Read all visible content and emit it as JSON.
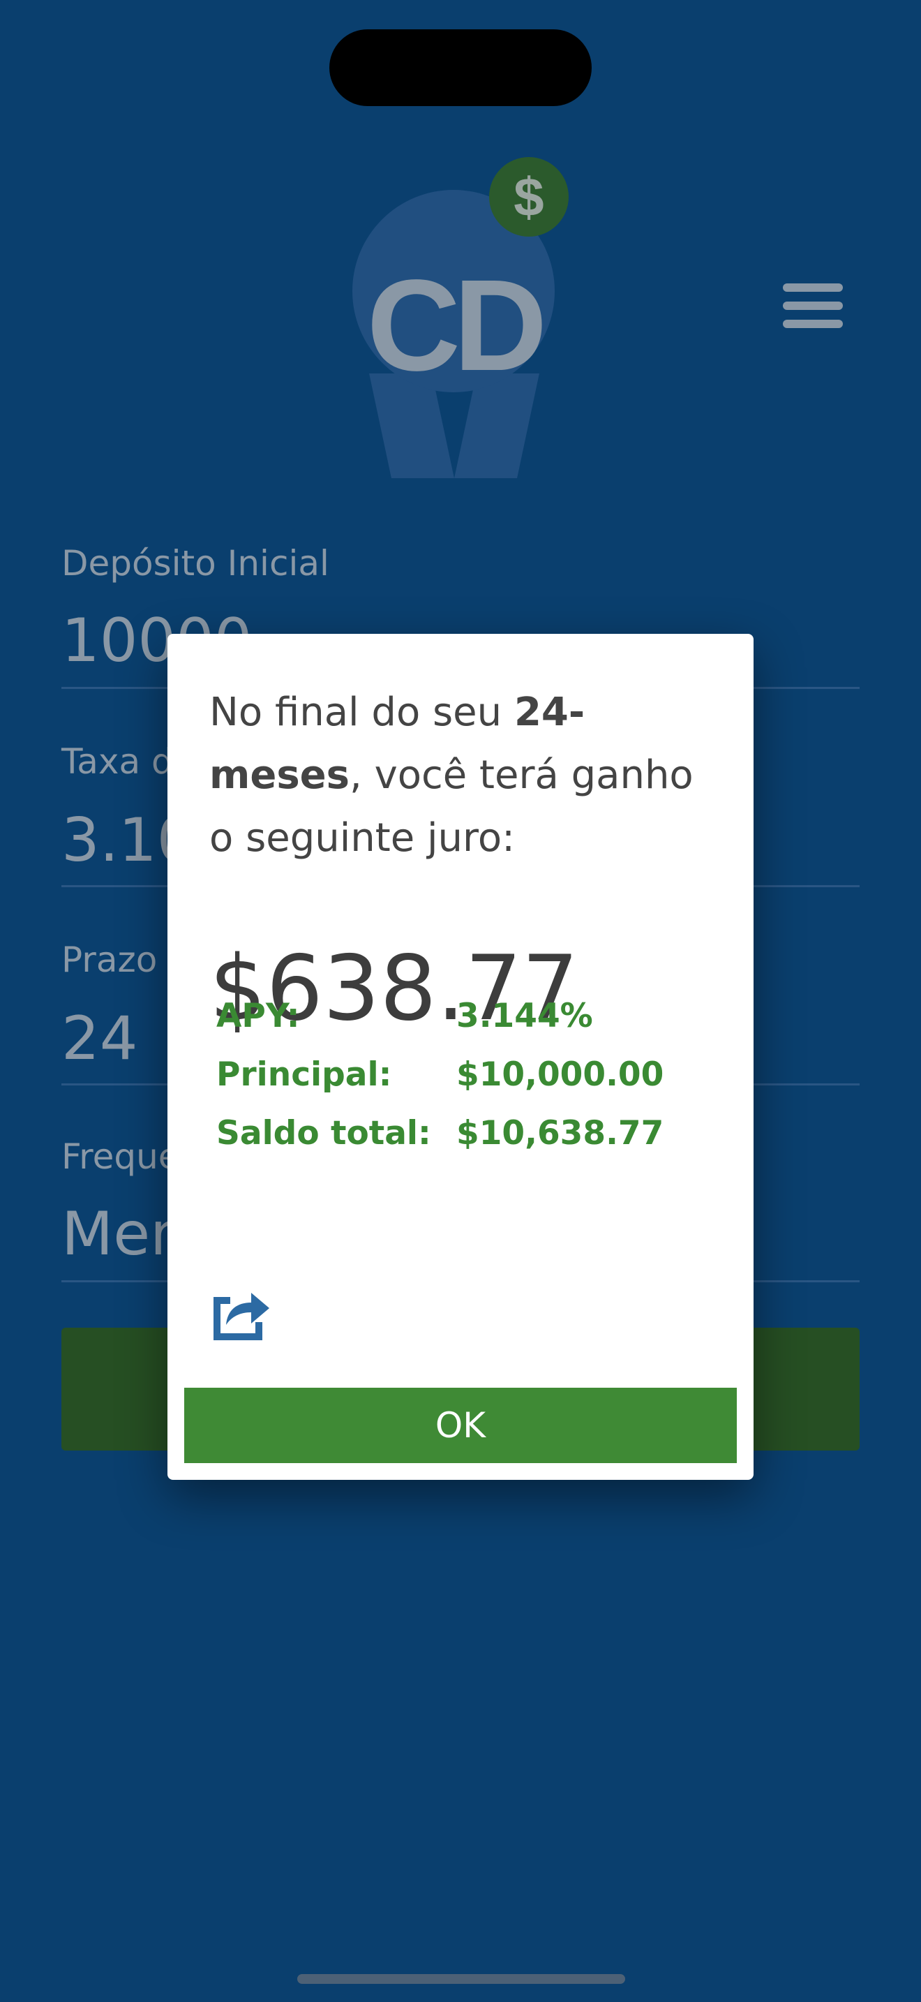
{
  "app": {
    "logo_text": "CD",
    "coin_symbol": "$"
  },
  "form": {
    "fields": [
      {
        "label": "Depósito Inicial",
        "value": "10000"
      },
      {
        "label": "Taxa d",
        "value": "3.10"
      },
      {
        "label": "Prazo",
        "value": "24"
      },
      {
        "label": "Freque",
        "value": "Men"
      }
    ]
  },
  "dialog": {
    "message_part1": "No final do seu ",
    "message_bold": "24-meses",
    "message_part2": ", você terá ganho o seguinte juro:",
    "interest_amount": "$638.77",
    "stats": [
      {
        "label": "APY:",
        "value": "3.144%"
      },
      {
        "label": "Principal:",
        "value": "$10,000.00"
      },
      {
        "label": "Saldo total:",
        "value": "$10,638.77"
      }
    ],
    "ok_label": "OK"
  },
  "colors": {
    "background": "#0a3f6e",
    "accent_green": "#3f8a35",
    "stat_green": "#3a8a33",
    "share_icon_blue": "#2c6aa3"
  }
}
